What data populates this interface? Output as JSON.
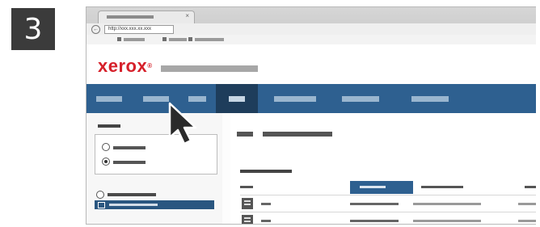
{
  "step": {
    "number": "3"
  },
  "browser": {
    "tab": {
      "close_glyph": "×"
    },
    "address": {
      "back_glyph": "←",
      "url": "http://xxx.xxx.xx.xxx"
    }
  },
  "header": {
    "logo_text": "xerox",
    "logo_mark": "®"
  },
  "colors": {
    "brand_red": "#d6202a",
    "nav_blue": "#2e6090",
    "nav_active": "#1e3d5b"
  },
  "icons": {
    "cursor": "arrow-pointer-icon",
    "list_item_b": "printer-icon",
    "rows": "document-icon"
  },
  "main": {
    "table": {
      "active_column_index": 1
    }
  }
}
